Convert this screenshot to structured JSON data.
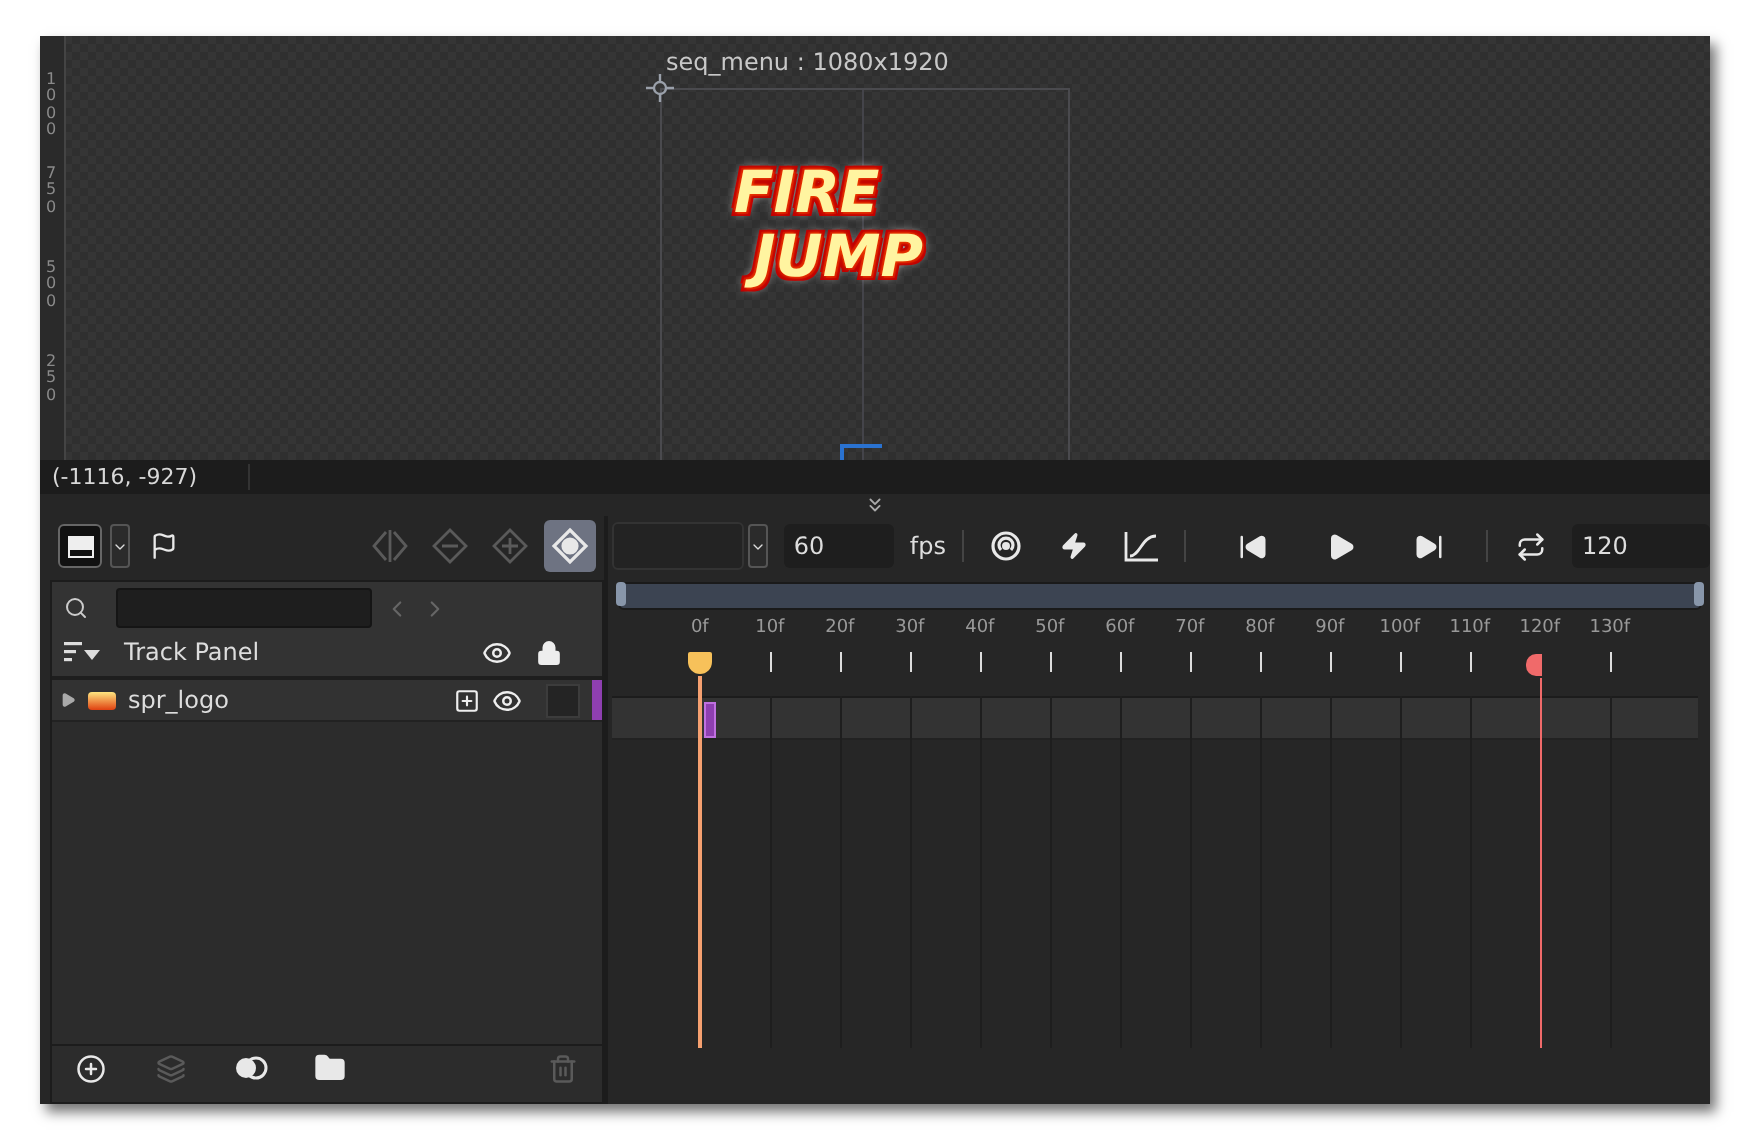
{
  "canvas": {
    "ruler_labels": [
      "1000",
      "750",
      "500",
      "250"
    ],
    "room_label": "seq_menu : 1080x1920",
    "logo_lines": [
      "FIRE",
      "JUMP"
    ]
  },
  "status_bar": {
    "coordinates": "(-1116, -927)"
  },
  "track_toolbar": {
    "view_button": {
      "selected": true
    },
    "keyframe_tools": [
      {
        "kind": "split",
        "disabled": true,
        "selected": false
      },
      {
        "kind": "remove",
        "disabled": true,
        "selected": false
      },
      {
        "kind": "add",
        "disabled": true,
        "selected": false
      },
      {
        "kind": "auto",
        "disabled": false,
        "selected": true
      }
    ]
  },
  "track_panel": {
    "title": "Track Panel",
    "tracks": [
      {
        "name": "spr_logo",
        "expanded": false,
        "color": "#8e3fb0"
      }
    ]
  },
  "bottom_tools": [
    {
      "kind": "add",
      "disabled": false
    },
    {
      "kind": "layer",
      "disabled": true
    },
    {
      "kind": "mask",
      "disabled": false
    },
    {
      "kind": "folder",
      "disabled": false
    },
    {
      "kind": "delete",
      "disabled": true
    }
  ],
  "playback": {
    "fps_value": "60",
    "fps_unit": "fps",
    "length": "120"
  },
  "timeline": {
    "labels": [
      "0f",
      "10f",
      "20f",
      "30f",
      "40f",
      "50f",
      "60f",
      "70f",
      "80f",
      "90f",
      "100f",
      "110f",
      "120f",
      "130f"
    ]
  }
}
